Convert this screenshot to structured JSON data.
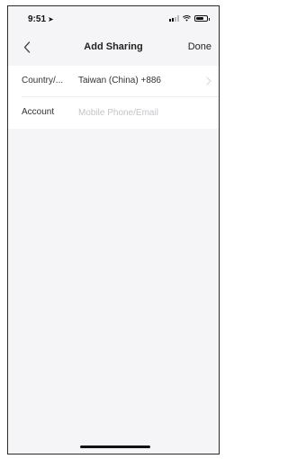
{
  "status_bar": {
    "time": "9:51",
    "icons": [
      "location-arrow-icon",
      "cellular-signal-icon",
      "wifi-icon",
      "battery-icon"
    ]
  },
  "nav": {
    "back_icon": "chevron-left-icon",
    "title": "Add Sharing",
    "done_label": "Done"
  },
  "form": {
    "country": {
      "label": "Country/...",
      "value": "Taiwan (China) +886",
      "icon": "chevron-right-icon"
    },
    "account": {
      "label": "Account",
      "value": "",
      "placeholder": "Mobile Phone/Email"
    }
  },
  "colors": {
    "background": "#f5f5f7",
    "card": "#ffffff",
    "text": "#222222",
    "placeholder": "#c4c4c8"
  }
}
